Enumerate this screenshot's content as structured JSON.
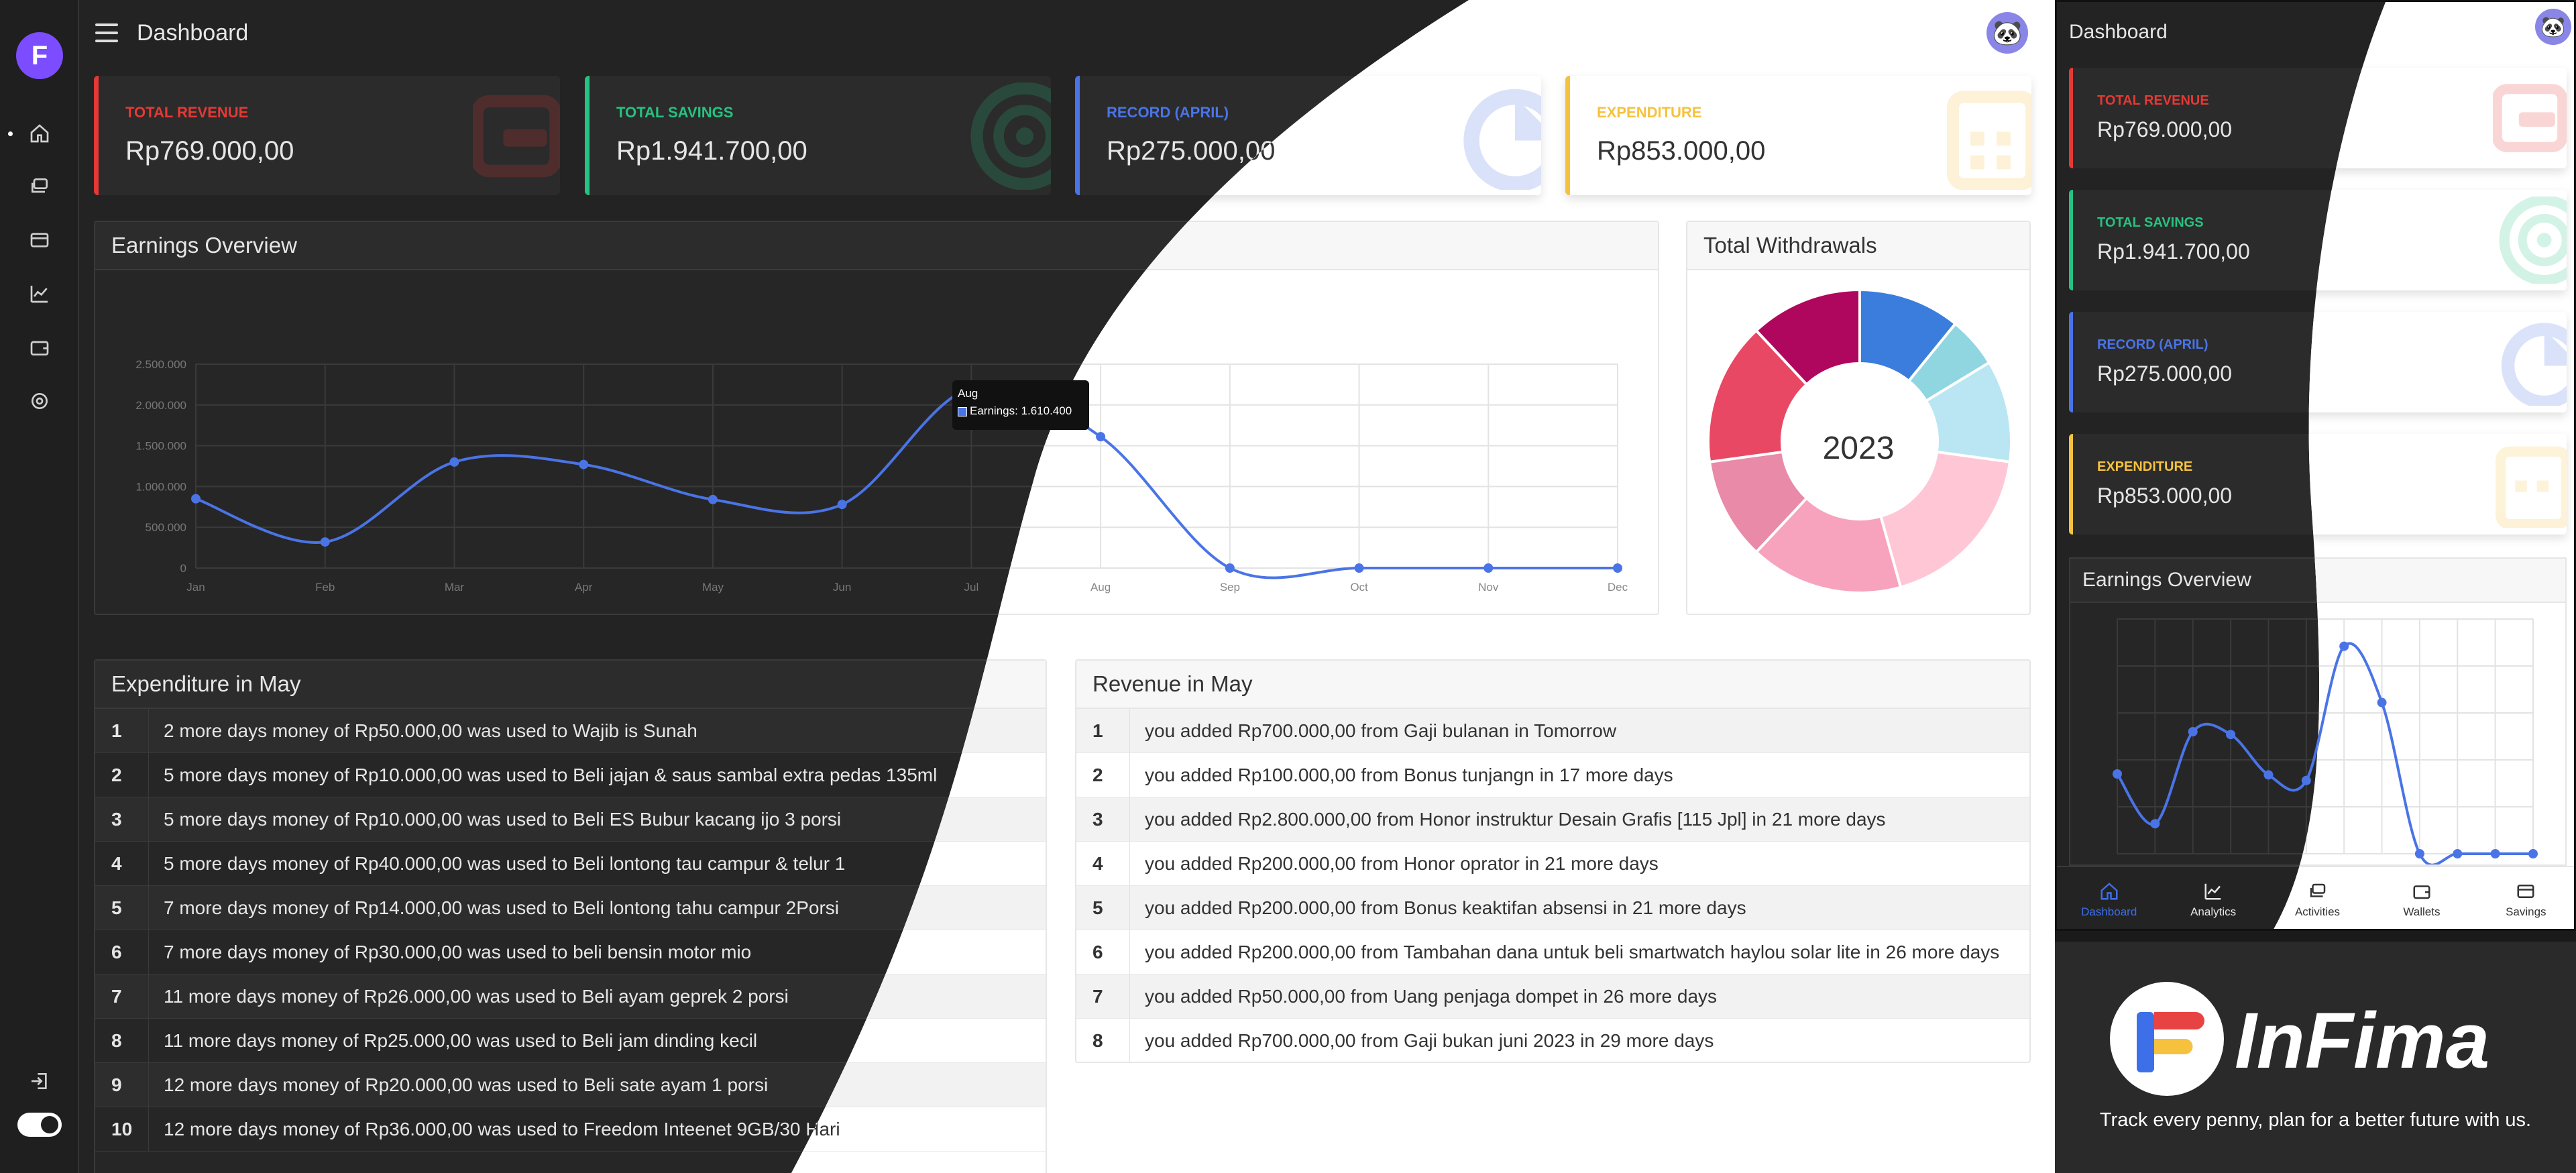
{
  "header": {
    "title": "Dashboard"
  },
  "sidebar": {
    "items": [
      "dashboard",
      "activities",
      "wallets",
      "analytics",
      "savings",
      "settings"
    ]
  },
  "cards": [
    {
      "label": "TOTAL REVENUE",
      "value": "Rp769.000,00",
      "color": "#e53935",
      "icon": "wallet-icon"
    },
    {
      "label": "TOTAL SAVINGS",
      "value": "Rp1.941.700,00",
      "color": "#26c281",
      "icon": "target-icon"
    },
    {
      "label": "RECORD (APRIL)",
      "value": "Rp275.000,00",
      "color": "#4a74e6",
      "icon": "pie-icon"
    },
    {
      "label": "EXPENDITURE",
      "value": "Rp853.000,00",
      "color": "#f6c23e",
      "icon": "calendar-icon"
    }
  ],
  "earnings": {
    "title": "Earnings Overview"
  },
  "withdrawals": {
    "title": "Total Withdrawals",
    "year": "2023"
  },
  "tooltip": {
    "month": "Aug",
    "text": "Earnings: 1.610.400"
  },
  "chart_data": [
    {
      "type": "line",
      "title": "Earnings Overview",
      "categories": [
        "Jan",
        "Feb",
        "Mar",
        "Apr",
        "May",
        "Jun",
        "Jul",
        "Aug",
        "Sep",
        "Oct",
        "Nov",
        "Dec"
      ],
      "values": [
        850000,
        320000,
        1300000,
        1270000,
        840000,
        780000,
        2210000,
        1610400,
        0,
        0,
        0,
        0
      ],
      "ylim": [
        0,
        2500000
      ],
      "yticks": [
        "0",
        "500.000",
        "1.000.000",
        "1.500.000",
        "2.000.000",
        "2.500.000"
      ],
      "color": "#4a74e6"
    },
    {
      "type": "pie",
      "title": "Total Withdrawals",
      "center_label": "2023",
      "values": [
        10,
        5,
        10,
        17,
        15,
        10,
        14,
        11
      ],
      "colors": [
        "#3b7ddd",
        "#8fd6e1",
        "#b9e6f2",
        "#ffc7d6",
        "#f7a3be",
        "#e88aa8",
        "#e84863",
        "#b0075e"
      ]
    }
  ],
  "expenditure": {
    "title": "Expenditure in May",
    "rows": [
      {
        "n": "1",
        "text": "2 more days money of Rp50.000,00 was used to Wajib is Sunah"
      },
      {
        "n": "2",
        "text": "5 more days money of Rp10.000,00 was used to Beli jajan & saus sambal extra pedas 135ml"
      },
      {
        "n": "3",
        "text": "5 more days money of Rp10.000,00 was used to Beli ES Bubur kacang ijo 3 porsi"
      },
      {
        "n": "4",
        "text": "5 more days money of Rp40.000,00 was used to Beli lontong tau campur & telur 1"
      },
      {
        "n": "5",
        "text": "7 more days money of Rp14.000,00 was used to Beli lontong tahu campur 2Porsi"
      },
      {
        "n": "6",
        "text": "7 more days money of Rp30.000,00 was used to beli bensin motor mio"
      },
      {
        "n": "7",
        "text": "11 more days money of Rp26.000,00 was used to Beli ayam geprek 2 porsi"
      },
      {
        "n": "8",
        "text": "11 more days money of Rp25.000,00 was used to Beli jam dinding kecil"
      },
      {
        "n": "9",
        "text": "12 more days money of Rp20.000,00 was used to Beli sate ayam 1 porsi"
      },
      {
        "n": "10",
        "text": "12 more days money of Rp36.000,00 was used to Freedom Inteenet 9GB/30 Hari"
      }
    ]
  },
  "revenue": {
    "title": "Revenue in May",
    "rows": [
      {
        "n": "1",
        "text": "you added Rp700.000,00 from Gaji bulanan in Tomorrow"
      },
      {
        "n": "2",
        "text": "you added Rp100.000,00 from Bonus tunjangn in 17 more days"
      },
      {
        "n": "3",
        "text": "you added Rp2.800.000,00 from Honor instruktur Desain Grafis [115 Jpl] in 21 more days"
      },
      {
        "n": "4",
        "text": "you added Rp200.000,00 from Honor oprator in 21 more days"
      },
      {
        "n": "5",
        "text": "you added Rp200.000,00 from Bonus keaktifan absensi in 21 more days"
      },
      {
        "n": "6",
        "text": "you added Rp200.000,00 from Tambahan dana untuk beli smartwatch haylou solar lite in 26 more days"
      },
      {
        "n": "7",
        "text": "you added Rp50.000,00 from Uang penjaga dompet in 26 more days"
      },
      {
        "n": "8",
        "text": "you added Rp700.000,00 from Gaji bukan juni 2023 in 29 more days"
      }
    ]
  },
  "mobile": {
    "title": "Dashboard",
    "earnings_title": "Earnings Overview",
    "nav": [
      {
        "label": "Dashboard",
        "icon": "home-icon"
      },
      {
        "label": "Analytics",
        "icon": "chart-icon"
      },
      {
        "label": "Activities",
        "icon": "cards-icon"
      },
      {
        "label": "Wallets",
        "icon": "wallet-icon"
      },
      {
        "label": "Savings",
        "icon": "savings-icon"
      }
    ]
  },
  "brand": {
    "name": "InFima",
    "tagline": "Track every penny, plan for a better future with us."
  },
  "colors": {
    "accent": "#7c4dff",
    "line": "#4a74e6",
    "dark_bg": "#232323",
    "light_bg": "#ffffff"
  }
}
